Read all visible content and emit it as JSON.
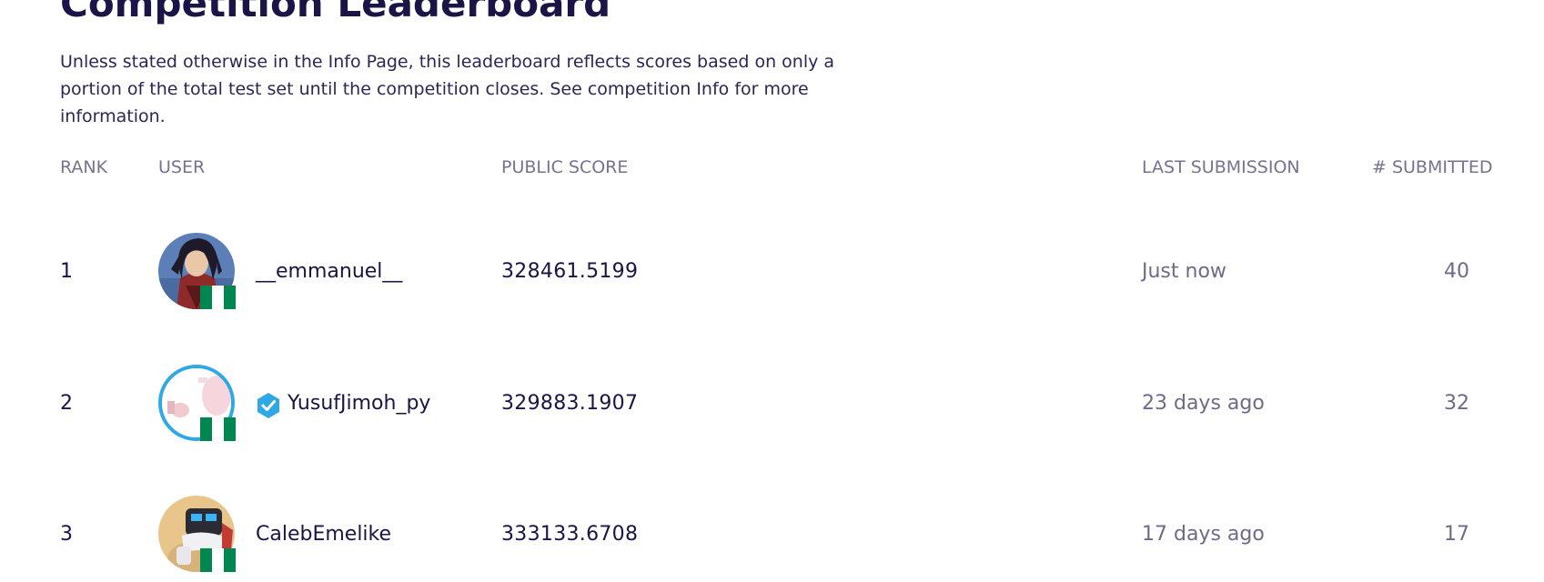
{
  "page": {
    "title": "Competition Leaderboard",
    "intro": "Unless stated otherwise in the Info Page, this leaderboard reflects scores based on only a portion of the total test set until the competition closes. See competition Info for more information."
  },
  "table": {
    "headers": {
      "rank": "RANK",
      "user": "USER",
      "public_score": "PUBLIC SCORE",
      "last_submission": "LAST SUBMISSION",
      "submitted": "# SUBMITTED"
    },
    "rows": [
      {
        "rank": "1",
        "username": "__emmanuel__",
        "verified": false,
        "avatar": "anime-character-avatar",
        "flag": "nigeria-flag-icon",
        "public_score": "328461.5199",
        "last_submission": "Just now",
        "submitted": "40"
      },
      {
        "rank": "2",
        "username": "YusufJimoh_py",
        "verified": true,
        "avatar": "pink-blurred-avatar",
        "flag": "nigeria-flag-icon",
        "public_score": "329883.1907",
        "last_submission": "23 days ago",
        "submitted": "32"
      },
      {
        "rank": "3",
        "username": "CalebEmelike",
        "verified": false,
        "avatar": "robot-avatar",
        "flag": "nigeria-flag-icon",
        "public_score": "333133.6708",
        "last_submission": "17 days ago",
        "submitted": "17"
      }
    ]
  },
  "colors": {
    "heading": "#1b1446",
    "muted": "#6f6a87",
    "verified_accent": "#2fa8e8",
    "nigeria_green": "#008751",
    "nigeria_white": "#ffffff"
  }
}
